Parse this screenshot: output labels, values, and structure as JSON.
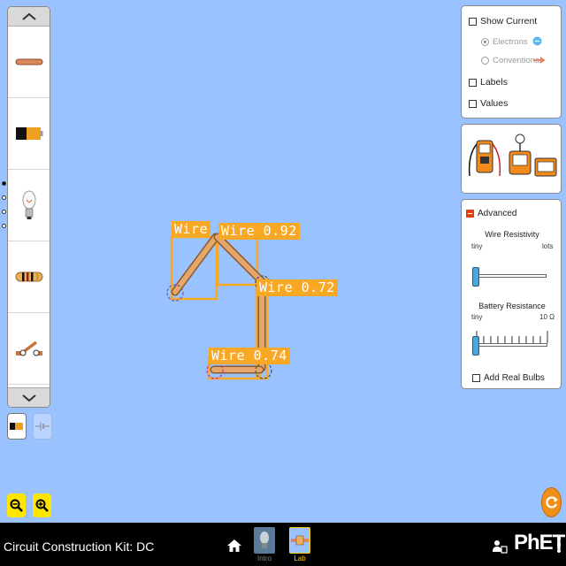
{
  "app": {
    "title": "Circuit Construction Kit: DC",
    "brand": "PhET"
  },
  "carousel": {
    "items": [
      "wire-icon",
      "battery-icon",
      "light-bulb-icon",
      "resistor-icon",
      "switch-icon"
    ],
    "page_count": 4,
    "current_page": 1
  },
  "view_buttons": [
    "lifelike-view-icon",
    "schematic-view-icon"
  ],
  "zoom": [
    "zoom-out-icon",
    "zoom-in-icon"
  ],
  "display_panel": {
    "show_current": "Show Current",
    "electrons": "Electrons",
    "conventional": "Conventional",
    "labels": "Labels",
    "values": "Values"
  },
  "tools_panel": {
    "tools": [
      "voltmeter-icon",
      "ammeter-icon",
      "non-contact-ammeter-icon"
    ]
  },
  "advanced_panel": {
    "title": "Advanced",
    "wire_resistivity": {
      "label": "Wire Resistivity",
      "min": "tiny",
      "max": "lots",
      "value": 0.0
    },
    "battery_resistance": {
      "label": "Battery Resistance",
      "min": "tiny",
      "max": "10 Ω",
      "value": 0.0
    },
    "add_real_bulbs": "Add Real Bulbs"
  },
  "detections": [
    {
      "text": "Wire 0.92"
    },
    {
      "text": "Wire 0.72"
    },
    {
      "text": "Wire 0.74"
    }
  ],
  "detection_partial_label": "Wire",
  "nav": {
    "screens": [
      {
        "label": "Intro",
        "active": false
      },
      {
        "label": "Lab",
        "active": true
      }
    ]
  },
  "colors": {
    "background": "#99c2ff",
    "detection": "#f9a825",
    "zoom": "#ffe600",
    "reset": "#f0901a",
    "nav_active": "#ffd000"
  }
}
